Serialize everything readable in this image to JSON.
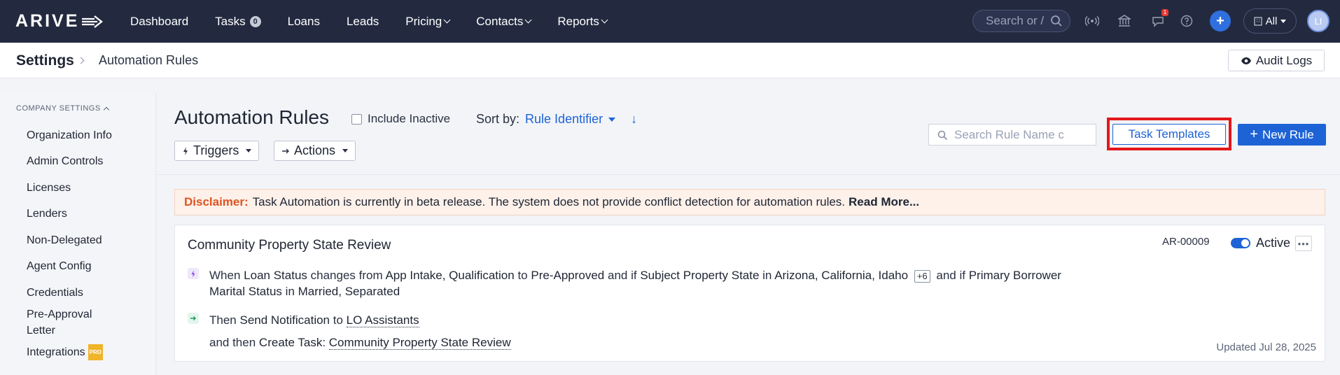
{
  "nav": {
    "logo": "ARIVE",
    "items": [
      {
        "label": "Dashboard"
      },
      {
        "label": "Tasks",
        "badge": "0"
      },
      {
        "label": "Loans"
      },
      {
        "label": "Leads"
      },
      {
        "label": "Pricing",
        "dropdown": true
      },
      {
        "label": "Contacts",
        "dropdown": true
      },
      {
        "label": "Reports",
        "dropdown": true
      }
    ],
    "search_placeholder": "Search or /",
    "notification_count": "1",
    "all_label": "All",
    "avatar_initials": "LI"
  },
  "breadcrumb": {
    "root": "Settings",
    "current": "Automation Rules",
    "audit_logs_label": "Audit Logs"
  },
  "sidebar": {
    "section_title": "COMPANY SETTINGS",
    "items": [
      {
        "label": "Organization Info"
      },
      {
        "label": "Admin Controls"
      },
      {
        "label": "Licenses"
      },
      {
        "label": "Lenders"
      },
      {
        "label": "Non-Delegated"
      },
      {
        "label": "Agent Config"
      },
      {
        "label": "Credentials"
      },
      {
        "label": "Pre-Approval Letter"
      },
      {
        "label": "Integrations",
        "badge": "PRO"
      }
    ]
  },
  "main": {
    "title": "Automation Rules",
    "include_inactive_label": "Include Inactive",
    "sort_by_label": "Sort by:",
    "sort_by_value": "Rule Identifier",
    "triggers_label": "Triggers",
    "actions_label": "Actions",
    "search_placeholder": "Search Rule Name c",
    "task_templates_label": "Task Templates",
    "new_rule_label": "New Rule",
    "disclaimer": {
      "label": "Disclaimer:",
      "text": "Task Automation is currently in beta release. The system does not provide conflict detection for automation rules.",
      "read_more": "Read More..."
    }
  },
  "rule": {
    "title": "Community Property State Review",
    "id": "AR-00009",
    "status": "Active",
    "when_prefix": "When",
    "field1": "Loan Status",
    "changes_from": "changes from",
    "from_values": "App Intake, Qualification",
    "to": "to",
    "to_value": "Pre-Approved",
    "and_if": "and if",
    "field2": "Subject Property State",
    "in": "in",
    "states": "Arizona, California, Idaho",
    "more_states": "+6",
    "and_if2": "and if",
    "field3": "Primary Borrower",
    "field3b": "Marital Status",
    "in2": "in",
    "marital_values": "Married, Separated",
    "then": "Then",
    "action1": "Send Notification",
    "action1_to": "to",
    "action1_target": "LO Assistants",
    "and_then": "and then",
    "action2": "Create Task:",
    "action2_target": "Community Property State Review",
    "updated": "Updated Jul 28, 2025"
  },
  "colors": {
    "nav_bg": "#232a40",
    "accent": "#1e63d6",
    "highlight": "#e3171b",
    "disclaimer_label": "#e0531f"
  }
}
